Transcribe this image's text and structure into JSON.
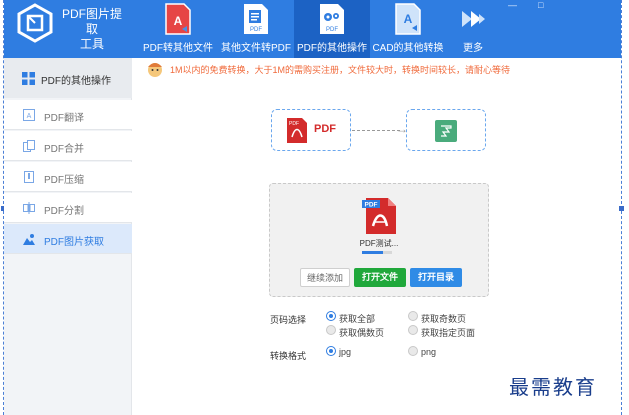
{
  "app": {
    "title_line1": "PDF图片提取",
    "title_line2": "工具"
  },
  "window_controls": [
    "—",
    "□"
  ],
  "toolbar": [
    {
      "label": "PDF转其他文件",
      "icon": "pdf-red-icon"
    },
    {
      "label": "其他文件转PDF",
      "icon": "doc-to-pdf-icon"
    },
    {
      "label": "PDF的其他操作",
      "icon": "gear-pdf-icon"
    },
    {
      "label": "CAD的其他转换",
      "icon": "cad-convert-icon"
    },
    {
      "label": "更多",
      "icon": "double-chevron-right-icon"
    }
  ],
  "sidebar": {
    "header": {
      "label": "PDF的其他操作",
      "icon": "grid-icon"
    },
    "items": [
      {
        "label": "PDF翻译",
        "icon": "translate-icon"
      },
      {
        "label": "PDF合并",
        "icon": "merge-icon"
      },
      {
        "label": "PDF压缩",
        "icon": "compress-icon"
      },
      {
        "label": "PDF分割",
        "icon": "split-icon"
      },
      {
        "label": "PDF图片获取",
        "icon": "image-extract-icon"
      }
    ]
  },
  "notice": {
    "text": "1M以内的免费转换，大于1M的需购买注册，文件较大时，转换时间较长，请耐心等待",
    "icon": "mascot-icon"
  },
  "flow": {
    "source_label": "PDF",
    "arrow": "→",
    "target_icon": "image-result-icon"
  },
  "file": {
    "name": "PDF测试...",
    "progress": 0.7
  },
  "buttons": {
    "continue": "继续添加",
    "open_file": "打开文件",
    "open_dir": "打开目录"
  },
  "options": {
    "page_label": "页码选择",
    "pages": [
      {
        "text": "获取全部",
        "checked": true
      },
      {
        "text": "获取奇数页",
        "checked": false
      },
      {
        "text": "获取偶数页",
        "checked": false
      },
      {
        "text": "获取指定页面",
        "checked": false
      }
    ],
    "format_label": "转换格式",
    "formats": [
      {
        "text": "jpg",
        "checked": true
      },
      {
        "text": "png",
        "checked": false
      }
    ]
  },
  "watermark": "最需教育",
  "colors": {
    "primary": "#2f7de1",
    "green": "#20a83b",
    "notice": "#f06a3b",
    "pdf_red": "#d32b2b"
  }
}
